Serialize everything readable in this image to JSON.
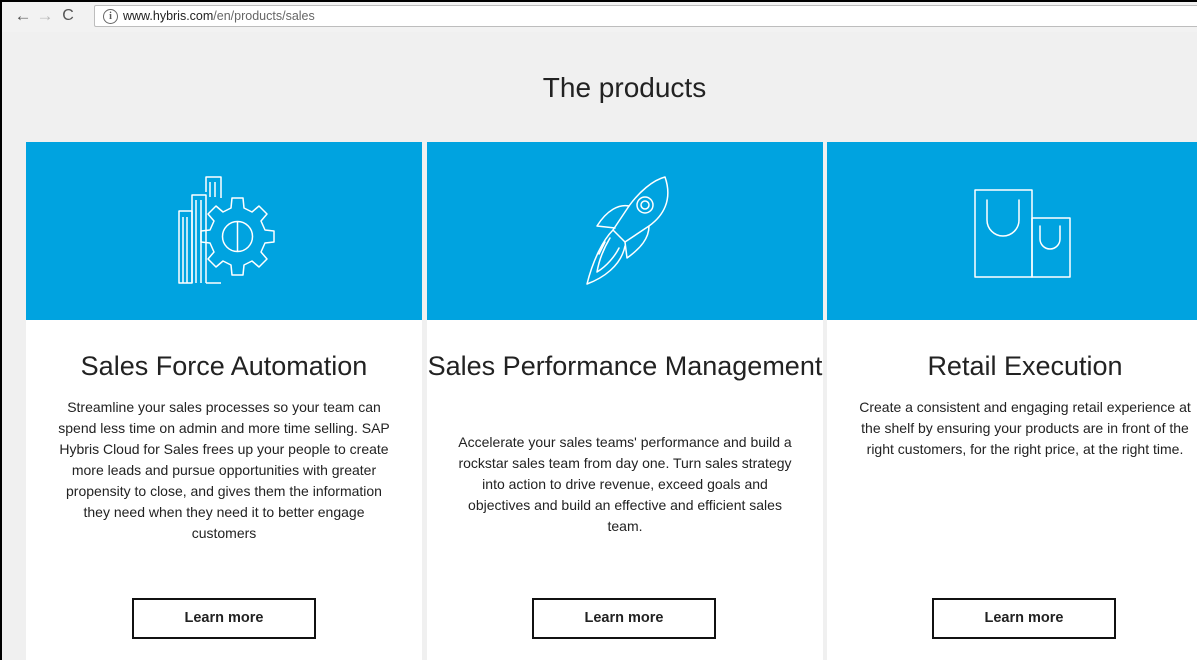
{
  "browser": {
    "back_icon": "←",
    "forward_icon": "→",
    "reload_icon": "C",
    "url_domain": "www.hybris.com",
    "url_path": "/en/products/sales"
  },
  "page": {
    "heading": "The products"
  },
  "colors": {
    "hero_blue": "#00a3e0",
    "page_background": "#f0f0f0"
  },
  "products": [
    {
      "icon": "bar-chart-gear-icon",
      "title": "Sales Force Automation",
      "description": "Streamline your sales processes so your team can spend less time on admin and more time selling. SAP Hybris Cloud for Sales frees up your people to create more leads and pursue opportunities with greater propensity to close, and gives them the information they need when they need it to better engage customers",
      "button": "Learn more"
    },
    {
      "icon": "rocket-icon",
      "title": "Sales Performance Management",
      "description": "Accelerate your sales teams' performance and build a rockstar sales team from day one. Turn sales strategy into action to drive revenue, exceed goals and objectives and build an effective and efficient sales team.",
      "button": "Learn more"
    },
    {
      "icon": "shopping-bags-icon",
      "title": "Retail Execution",
      "description": "Create a consistent and engaging retail experience at the shelf by ensuring your products are in front of the right customers, for the right price, at the right time.",
      "button": "Learn more"
    }
  ]
}
